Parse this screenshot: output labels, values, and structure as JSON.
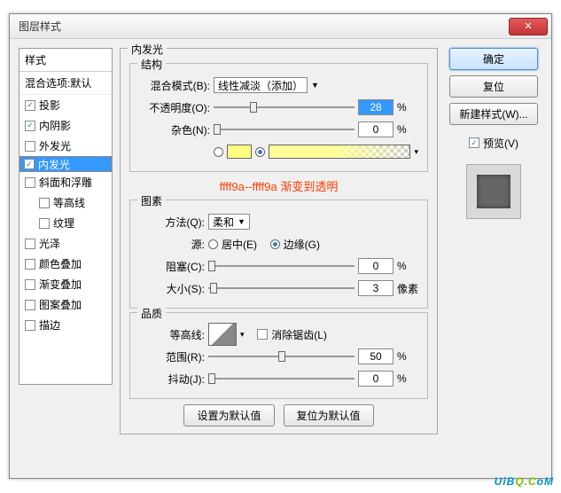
{
  "window": {
    "title": "图层样式",
    "close": "✕"
  },
  "styles": {
    "header": "样式",
    "blend_default": "混合选项:默认",
    "items": [
      {
        "label": "投影",
        "checked": true
      },
      {
        "label": "内阴影",
        "checked": true
      },
      {
        "label": "外发光",
        "checked": false
      },
      {
        "label": "内发光",
        "checked": true,
        "selected": true
      },
      {
        "label": "斜面和浮雕",
        "checked": false
      },
      {
        "label": "等高线",
        "checked": false,
        "sub": true
      },
      {
        "label": "纹理",
        "checked": false,
        "sub": true
      },
      {
        "label": "光泽",
        "checked": false
      },
      {
        "label": "颜色叠加",
        "checked": false
      },
      {
        "label": "渐变叠加",
        "checked": false
      },
      {
        "label": "图案叠加",
        "checked": false
      },
      {
        "label": "描边",
        "checked": false
      }
    ]
  },
  "panel": {
    "title": "内发光",
    "structure": {
      "title": "结构",
      "blend_label": "混合模式(B):",
      "blend_value": "线性减淡（添加）",
      "opacity_label": "不透明度(O):",
      "opacity_value": "28",
      "opacity_unit": "%",
      "noise_label": "杂色(N):",
      "noise_value": "0",
      "noise_unit": "%",
      "color_hex": "#ffff80",
      "gradient_note": "ffff9a--ffff9a 渐变到透明"
    },
    "elements": {
      "title": "图素",
      "technique_label": "方法(Q):",
      "technique_value": "柔和",
      "source_label": "源:",
      "source_center": "居中(E)",
      "source_edge": "边缘(G)",
      "choke_label": "阻塞(C):",
      "choke_value": "0",
      "choke_unit": "%",
      "size_label": "大小(S):",
      "size_value": "3",
      "size_unit": "像素"
    },
    "quality": {
      "title": "品质",
      "contour_label": "等高线:",
      "antialias_label": "消除锯齿(L)",
      "range_label": "范围(R):",
      "range_value": "50",
      "range_unit": "%",
      "jitter_label": "抖动(J):",
      "jitter_value": "0",
      "jitter_unit": "%"
    },
    "reset_btn": "设置为默认值",
    "restore_btn": "复位为默认值"
  },
  "right": {
    "ok": "确定",
    "cancel": "复位",
    "newstyle": "新建样式(W)...",
    "preview_label": "预览(V)"
  },
  "watermark": {
    "a": "UiB",
    "b": "Q.C",
    "c": "oM"
  }
}
